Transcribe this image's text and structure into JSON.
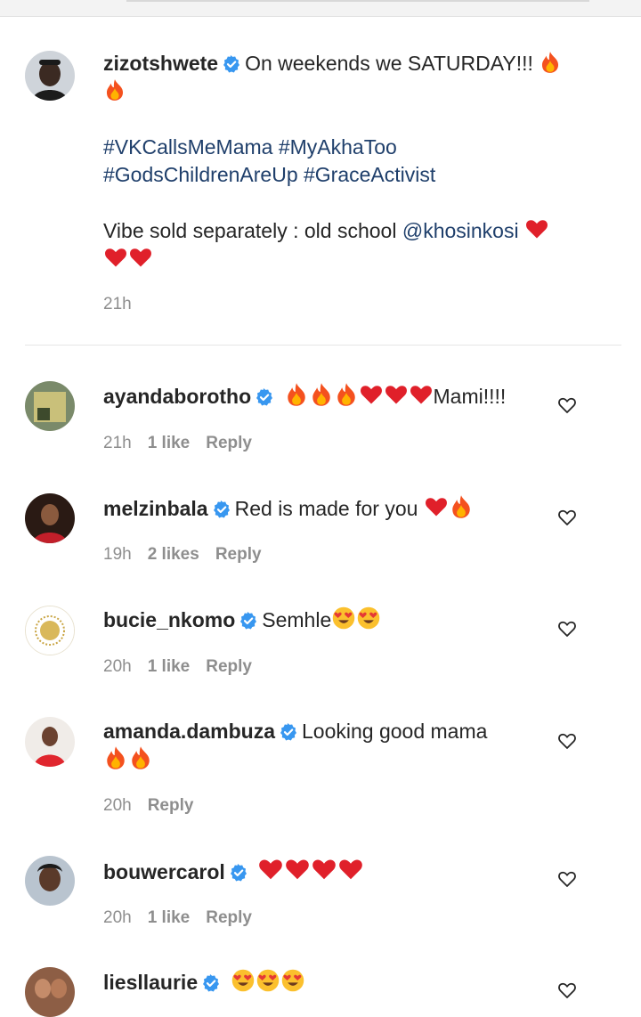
{
  "caption": {
    "username": "zizotshwete",
    "line1": "On weekends we SATURDAY!!!",
    "tags1": "#VKCallsMeMama #MyAkhaToo",
    "tags2": "#GodsChildrenAreUp #GraceActivist",
    "vibe": "Vibe sold separately : old school ",
    "mention": "@khosinkosi",
    "time": "21h"
  },
  "comments": [
    {
      "username": "ayandaborotho",
      "text": "Mami!!!!",
      "time": "21h",
      "likes": "1 like",
      "reply": "Reply"
    },
    {
      "username": "melzinbala",
      "text": "Red is made for you",
      "time": "19h",
      "likes": "2 likes",
      "reply": "Reply"
    },
    {
      "username": "bucie_nkomo",
      "text": "Semhle",
      "time": "20h",
      "likes": "1 like",
      "reply": "Reply"
    },
    {
      "username": "amanda.dambuza",
      "text": "Looking good mama",
      "time": "20h",
      "likes": "",
      "reply": "Reply"
    },
    {
      "username": "bouwercarol",
      "text": "",
      "time": "20h",
      "likes": "1 like",
      "reply": "Reply"
    },
    {
      "username": "liesllaurie",
      "text": "",
      "time": "",
      "likes": "",
      "reply": ""
    }
  ],
  "icons": [
    "verified-badge-icon",
    "heart-outline-icon",
    "fire-emoji",
    "red-heart-emoji",
    "heart-eyes-emoji"
  ],
  "colors": {
    "verified": "#3897f0",
    "hashtag": "#1f3f6b",
    "meta": "#8e8e8e",
    "text": "#262626"
  }
}
